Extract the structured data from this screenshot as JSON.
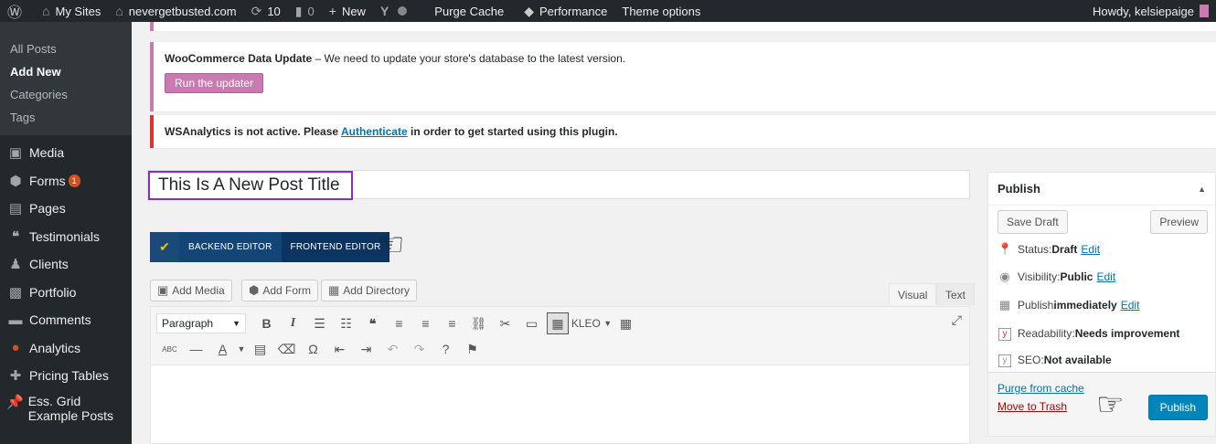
{
  "adminbar": {
    "wp_logo": "wordpress-icon",
    "my_sites": "My Sites",
    "site_name": "nevergetbusted.com",
    "updates_count": "10",
    "comments_count": "0",
    "new_label": "New",
    "purge_cache": "Purge Cache",
    "performance": "Performance",
    "theme_options": "Theme options",
    "howdy": "Howdy, kelsiepaige"
  },
  "sidebar": {
    "submenu": [
      {
        "label": "All Posts"
      },
      {
        "label": "Add New"
      },
      {
        "label": "Categories"
      },
      {
        "label": "Tags"
      }
    ],
    "items": [
      {
        "label": "Media",
        "icon": "media-icon"
      },
      {
        "label": "Forms",
        "icon": "forms-icon",
        "badge": "1"
      },
      {
        "label": "Pages",
        "icon": "pages-icon"
      },
      {
        "label": "Testimonials",
        "icon": "quote-icon"
      },
      {
        "label": "Clients",
        "icon": "clients-icon"
      },
      {
        "label": "Portfolio",
        "icon": "portfolio-icon"
      },
      {
        "label": "Comments",
        "icon": "comments-icon"
      },
      {
        "label": "Analytics",
        "icon": "analytics-icon"
      },
      {
        "label": "Pricing Tables",
        "icon": "plus-icon"
      },
      {
        "label": "Ess. Grid Example Posts",
        "icon": "pin-icon"
      }
    ]
  },
  "notices": {
    "woo": {
      "strong": "WooCommerce Data Update",
      "text": " – We need to update your store's database to the latest version.",
      "button": "Run the updater"
    },
    "ws": {
      "text_before": "WSAnalytics is not active. Please ",
      "link": "Authenticate",
      "text_after": " in order to get started using this plugin."
    }
  },
  "post": {
    "title": "This Is A New Post Title"
  },
  "editor_switch": {
    "backend": "BACKEND EDITOR",
    "frontend": "FRONTEND EDITOR"
  },
  "media_buttons": {
    "add_media": "Add Media",
    "add_form": "Add Form",
    "add_directory": "Add Directory"
  },
  "editor_tabs": {
    "visual": "Visual",
    "text": "Text"
  },
  "toolbar": {
    "format": "Paragraph",
    "kleo": "KLEO"
  },
  "publish": {
    "title": "Publish",
    "save_draft": "Save Draft",
    "preview": "Preview",
    "status_label": "Status: ",
    "status_value": "Draft",
    "visibility_label": "Visibility: ",
    "visibility_value": "Public",
    "publish_label": "Publish ",
    "publish_value": "immediately",
    "readability_label": "Readability: ",
    "readability_value": "Needs improvement",
    "seo_label": "SEO: ",
    "seo_value": "Not available",
    "edit": "Edit",
    "purge": "Purge from cache",
    "trash": "Move to Trash",
    "publish_button": "Publish"
  },
  "colors": {
    "adminbar": "#23282d",
    "woo_purple": "#c97bb1",
    "title_highlight": "#8b2cc9",
    "publish_blue": "#0085ba"
  }
}
